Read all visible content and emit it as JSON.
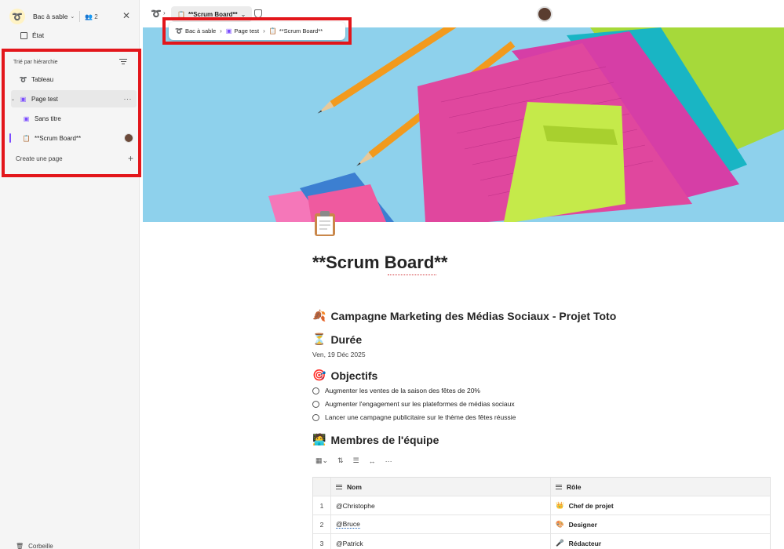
{
  "sidebar": {
    "workspace_name": "Bac à sable",
    "member_count": "2",
    "etat_label": "État",
    "hierarchy_label": "Trié par hiérarchie",
    "items": [
      {
        "label": "Tableau"
      },
      {
        "label": "Page test"
      },
      {
        "label": "Sans titre"
      },
      {
        "label": "**Scrum Board**"
      }
    ],
    "create_label": "Create une page",
    "trash_label": "Corbeille"
  },
  "topbar": {
    "tab_label": "**Scrum Board**"
  },
  "breadcrumb": {
    "items": [
      "Bac à sable",
      "Page test",
      "**Scrum Board**"
    ]
  },
  "page": {
    "title": "**Scrum Board**",
    "campaign_heading": "Campagne Marketing des Médias Sociaux - Projet Toto",
    "duration_heading": "Durée",
    "date": "Ven, 19 Déc 2025",
    "objectives_heading": "Objectifs",
    "objectives": [
      "Augmenter les ventes de la saison des fêtes de 20%",
      "Augmenter l'engagement sur les plateformes de médias sociaux",
      "Lancer une campagne publicitaire sur le thème des fêtes réussie"
    ],
    "team_heading": "Membres de l'équipe"
  },
  "table": {
    "headers": [
      "Nom",
      "Rôle"
    ],
    "rows": [
      {
        "num": "1",
        "name": "@Christophe",
        "role": "Chef de projet",
        "role_icon": "👑"
      },
      {
        "num": "2",
        "name": "@Bruce",
        "role": "Designer",
        "role_icon": "🎨"
      },
      {
        "num": "3",
        "name": "@Patrick",
        "role": "Rédacteur",
        "role_icon": "🎤"
      }
    ]
  },
  "colors": {
    "highlight": "#e3161b",
    "banner_bg": "#8ed1ec",
    "accent": "#7c4dff"
  }
}
